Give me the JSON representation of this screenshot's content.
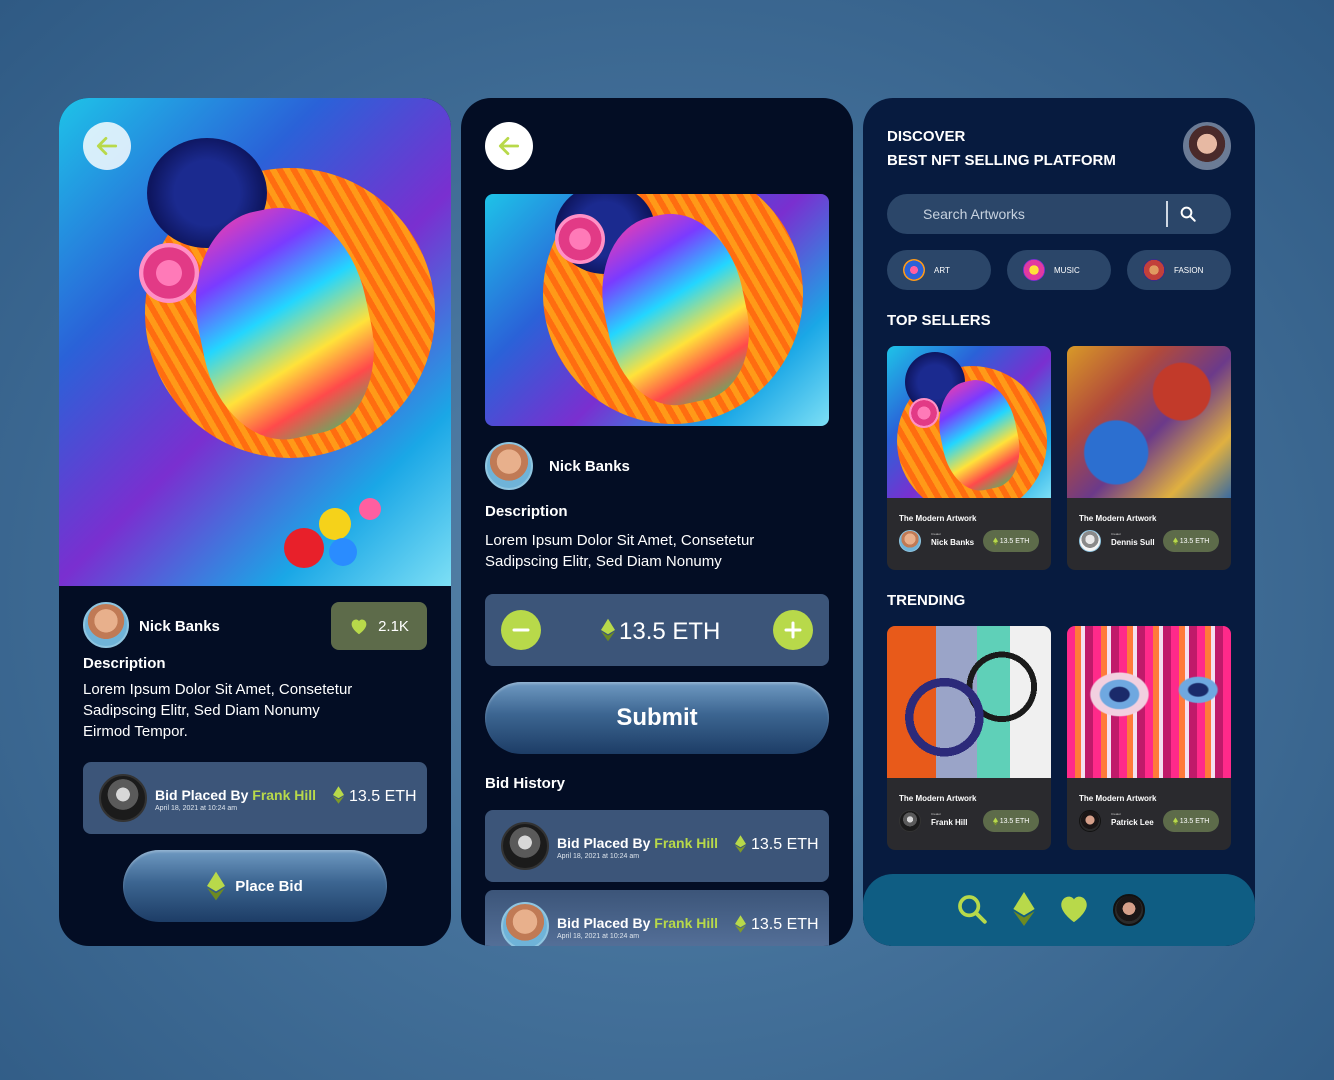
{
  "colors": {
    "accent": "#b8d94a",
    "dark_bg": "#030d24",
    "card_bg": "#3c5579",
    "like_bg": "#5d6b4a"
  },
  "detail": {
    "back_icon": "arrow-left-icon",
    "creator_name": "Nick Banks",
    "likes": "2.1K",
    "description_label": "Description",
    "description_lines": [
      "Lorem Ipsum Dolor Sit Amet, Consetetur",
      "Sadipscing Elitr, Sed Diam Nonumy",
      "Eirmod Tempor."
    ],
    "bid": {
      "prefix": "Bid Placed By",
      "name": "Frank Hill",
      "date": "April 18, 2021 at 10:24 am",
      "amount": "13.5 ETH"
    },
    "place_bid_label": "Place Bid"
  },
  "bid_screen": {
    "creator_name": "Nick Banks",
    "description_label": "Description",
    "description_lines": [
      "Lorem Ipsum Dolor Sit Amet, Consetetur",
      "Sadipscing Elitr, Sed Diam Nonumy"
    ],
    "amount": "13.5 ETH",
    "submit_label": "Submit",
    "history_label": "Bid History",
    "history": [
      {
        "prefix": "Bid Placed By",
        "name": "Frank Hill",
        "date": "April 18, 2021 at 10:24 am",
        "amount": "13.5 ETH"
      },
      {
        "prefix": "Bid Placed By",
        "name": "Frank Hill",
        "date": "April 18, 2021 at 10:24 am",
        "amount": "13.5 ETH"
      }
    ]
  },
  "discover": {
    "title_line1": "DISCOVER",
    "title_line2": "BEST NFT SELLING PLATFORM",
    "search_placeholder": "Search Artworks",
    "categories": [
      "ART",
      "MUSIC",
      "FASION"
    ],
    "top_sellers_label": "TOP SELLERS",
    "trending_label": "TRENDING",
    "top_sellers": [
      {
        "title": "The Modern Artwork",
        "role": "Creator",
        "name": "Nick Banks",
        "price": "13.5 ETH"
      },
      {
        "title": "The Modern Artwork",
        "role": "Creator",
        "name": "Dennis Sull",
        "price": "13.5 ETH"
      }
    ],
    "trending": [
      {
        "title": "The Modern Artwork",
        "role": "Creator",
        "name": "Frank Hill",
        "price": "13.5 ETH"
      },
      {
        "title": "The Modern Artwork",
        "role": "Creator",
        "name": "Patrick Lee",
        "price": "13.5 ETH"
      }
    ],
    "nav_icons": [
      "search-icon",
      "ethereum-icon",
      "heart-icon",
      "profile-avatar"
    ]
  }
}
